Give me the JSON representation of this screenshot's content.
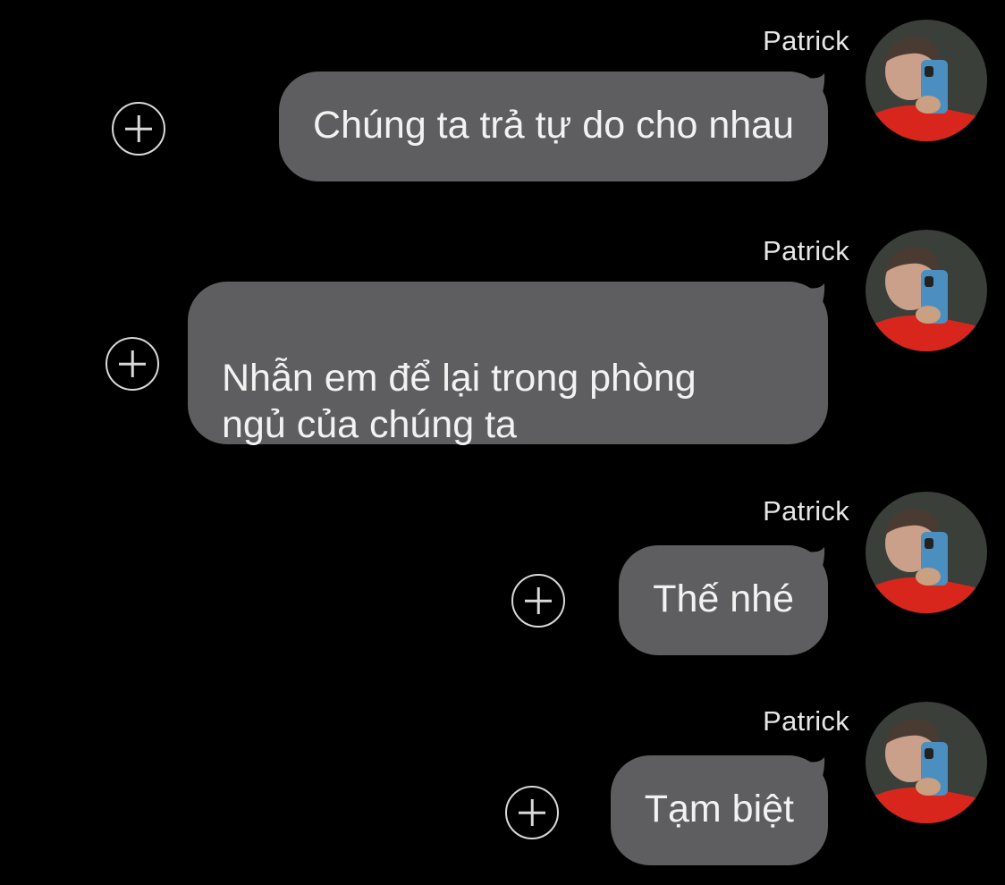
{
  "messages": [
    {
      "sender": "Patrick",
      "text": "Chúng ta trả tự do cho nhau"
    },
    {
      "sender": "Patrick",
      "text": "Nhẫn em để lại trong phòng\nngủ của chúng ta"
    },
    {
      "sender": "Patrick",
      "text": "Thế nhé"
    },
    {
      "sender": "Patrick",
      "text": "Tạm biệt"
    }
  ],
  "colors": {
    "background": "#000000",
    "bubble": "#5e5e60",
    "text": "#f2f2f2",
    "icon_outline": "#d9d9d9"
  },
  "icons": {
    "reaction_button": "plus-circle-icon",
    "avatar": "profile-photo"
  }
}
